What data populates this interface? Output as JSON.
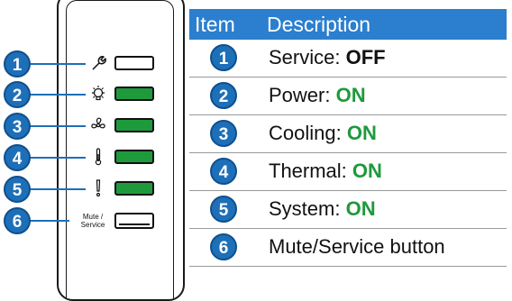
{
  "header": {
    "item": "Item",
    "description": "Description"
  },
  "rows": [
    {
      "number": "1",
      "label": "Service: ",
      "status": "OFF",
      "state": "off"
    },
    {
      "number": "2",
      "label": "Power: ",
      "status": "ON",
      "state": "on"
    },
    {
      "number": "3",
      "label": "Cooling: ",
      "status": "ON",
      "state": "on"
    },
    {
      "number": "4",
      "label": "Thermal: ",
      "status": "ON",
      "state": "on"
    },
    {
      "number": "5",
      "label": "System: ",
      "status": "ON",
      "state": "on"
    },
    {
      "number": "6",
      "label": "Mute/Service button",
      "status": "",
      "state": ""
    }
  ],
  "panel": {
    "callouts": [
      "1",
      "2",
      "3",
      "4",
      "5",
      "6"
    ],
    "icons": [
      "wrench-icon",
      "lightbulb-icon",
      "fan-icon",
      "thermometer-icon",
      "exclamation-icon"
    ],
    "mute_label_line1": "Mute /",
    "mute_label_line2": "Service"
  },
  "colors": {
    "accent_blue": "#1d6fb8",
    "header_blue": "#2b7fce",
    "on_green": "#1e9a3c"
  }
}
